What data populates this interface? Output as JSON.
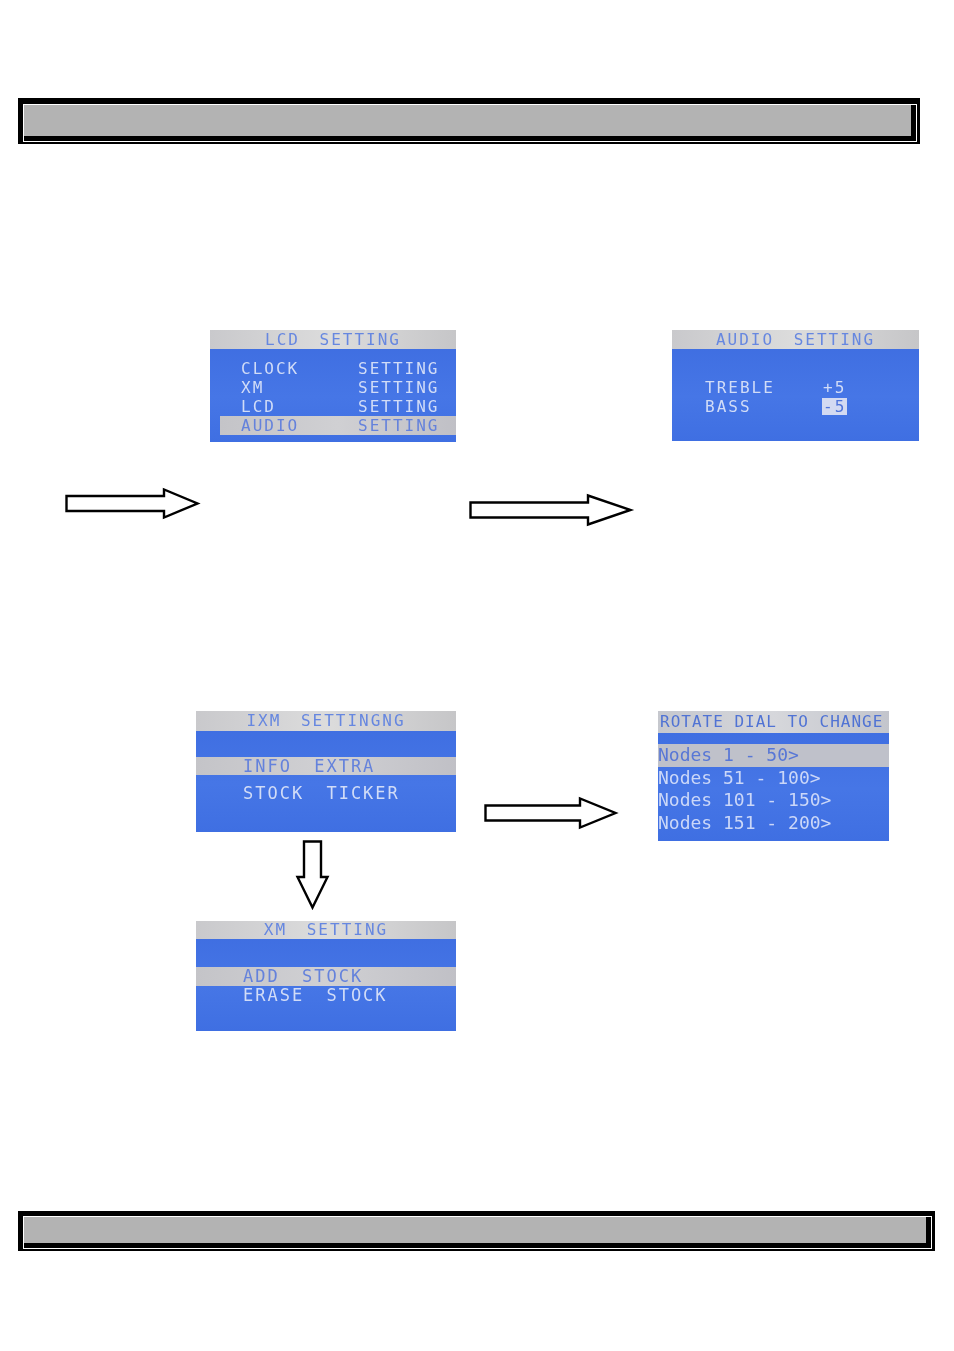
{
  "screens": [
    {
      "kind": "menu",
      "title": "LCD SETTING",
      "rows": [
        {
          "label": "CLOCK",
          "value": "SETTING",
          "selected": false
        },
        {
          "label": "XM",
          "value": "SETTING",
          "selected": false
        },
        {
          "label": "LCD",
          "value": "SETTING",
          "selected": false
        },
        {
          "label": "AUDIO",
          "value": "SETTING",
          "selected": true
        }
      ]
    },
    {
      "kind": "adjust",
      "title": "AUDIO SETTING",
      "rows": [
        {
          "label": "TREBLE",
          "value": "+5",
          "selected": false
        },
        {
          "label": "BASS",
          "value": "-5",
          "selected": true
        }
      ]
    },
    {
      "kind": "list",
      "title": "IXM SETTINGNG",
      "rows": [
        {
          "label": "INFO EXTRA",
          "selected": true
        },
        {
          "label": "STOCK TICKER",
          "selected": false
        }
      ]
    },
    {
      "kind": "dial",
      "title": "ROTATE DIAL TO CHANGE",
      "rows": [
        {
          "label": "Nodes 1 - 50>",
          "selected": true
        },
        {
          "label": "Nodes 51 - 100>",
          "selected": false
        },
        {
          "label": "Nodes 101 - 150>",
          "selected": false
        },
        {
          "label": "Nodes 151 - 200>",
          "selected": false
        }
      ]
    },
    {
      "kind": "list",
      "title": "XM SETTING",
      "rows": [
        {
          "label": "ADD STOCK",
          "selected": true
        },
        {
          "label": "ERASE STOCK",
          "selected": false
        }
      ]
    }
  ]
}
